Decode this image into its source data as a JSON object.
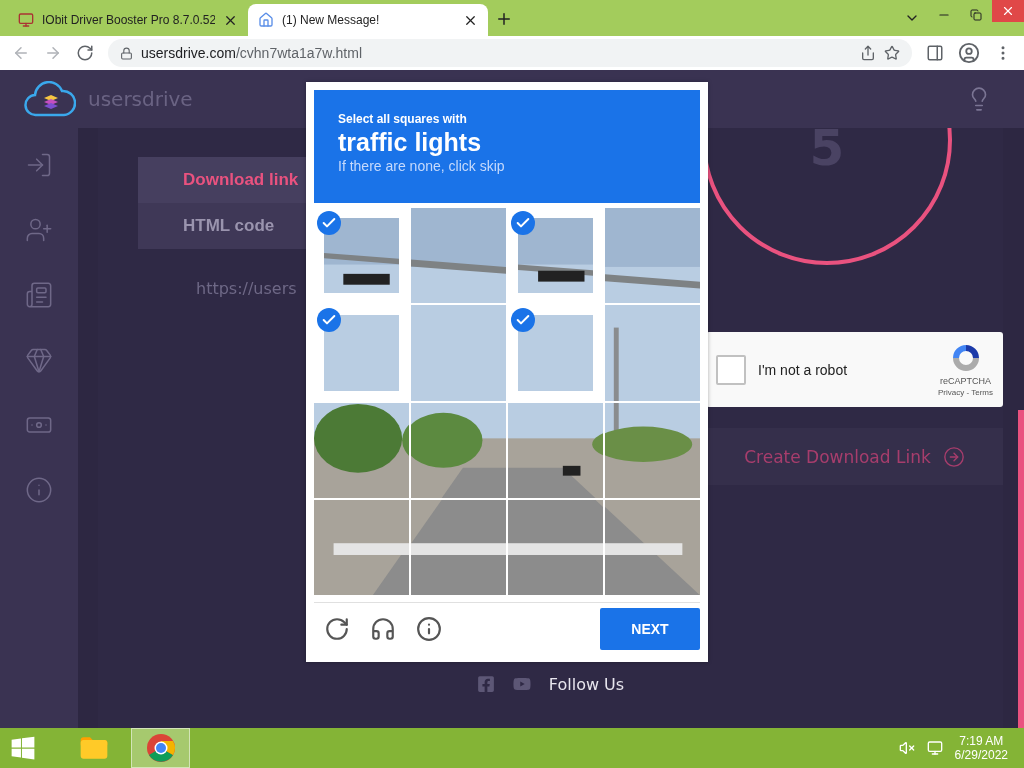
{
  "browser": {
    "tabs": [
      {
        "title": "IObit Driver Booster Pro 8.7.0.52",
        "selected": false
      },
      {
        "title": "(1) New Message!",
        "selected": true
      }
    ],
    "url": {
      "domain": "usersdrive.com",
      "path": "/cvhn7wta1a7w.html"
    }
  },
  "site": {
    "brand": "usersdrive",
    "nav_tabs": [
      {
        "label": "Download link",
        "selected": true
      },
      {
        "label": "HTML code",
        "selected": false
      }
    ],
    "link_text": "https://users",
    "countdown": "5",
    "recaptcha": {
      "label": "I'm not a robot",
      "checked": false,
      "brand": "reCAPTCHA",
      "links": "Privacy - Terms"
    },
    "create_button": "Create Download Link",
    "footer": "Follow Us"
  },
  "challenge": {
    "intro": "Select all squares with",
    "target": "traffic lights",
    "hint": "If there are none, click skip",
    "tiles": [
      {
        "selected": true
      },
      {
        "selected": false
      },
      {
        "selected": true
      },
      {
        "selected": false
      },
      {
        "selected": true
      },
      {
        "selected": false
      },
      {
        "selected": true
      },
      {
        "selected": false
      },
      {
        "selected": false
      },
      {
        "selected": false
      },
      {
        "selected": false
      },
      {
        "selected": false
      },
      {
        "selected": false
      },
      {
        "selected": false
      },
      {
        "selected": false
      },
      {
        "selected": false
      }
    ],
    "button": "NEXT"
  },
  "taskbar": {
    "apps": [
      {
        "kind": "explorer",
        "selected": false
      },
      {
        "kind": "chrome",
        "selected": true
      }
    ],
    "time": "7:19 AM",
    "date": "6/29/2022"
  }
}
